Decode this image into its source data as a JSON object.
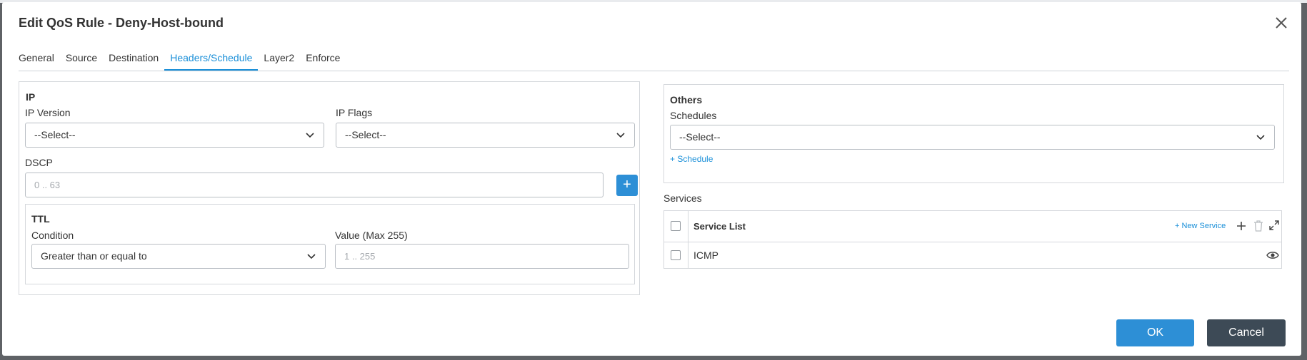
{
  "dialog": {
    "title": "Edit QoS Rule - Deny-Host-bound"
  },
  "tabs": [
    {
      "label": "General"
    },
    {
      "label": "Source"
    },
    {
      "label": "Destination"
    },
    {
      "label": "Headers/Schedule"
    },
    {
      "label": "Layer2"
    },
    {
      "label": "Enforce"
    }
  ],
  "active_tab": "Headers/Schedule",
  "ip": {
    "section_title": "IP",
    "ip_version_label": "IP Version",
    "ip_version_value": "--Select--",
    "ip_flags_label": "IP Flags",
    "ip_flags_value": "--Select--",
    "dscp_label": "DSCP",
    "dscp_placeholder": "0 .. 63",
    "dscp_add": "+"
  },
  "ttl": {
    "section_title": "TTL",
    "condition_label": "Condition",
    "condition_value": "Greater than or equal to",
    "value_label": "Value (Max 255)",
    "value_placeholder": "1 .. 255"
  },
  "others": {
    "section_title": "Others",
    "schedules_label": "Schedules",
    "schedules_value": "--Select--",
    "add_schedule_link": "+ Schedule"
  },
  "services": {
    "label": "Services",
    "column_header": "Service List",
    "new_service_link": "+ New Service",
    "rows": [
      {
        "name": "ICMP"
      }
    ]
  },
  "footer": {
    "ok_label": "OK",
    "cancel_label": "Cancel"
  },
  "colors": {
    "accent": "#1a8fd8",
    "primary_button": "#2d8fd6",
    "cancel_button": "#3d4a56"
  }
}
